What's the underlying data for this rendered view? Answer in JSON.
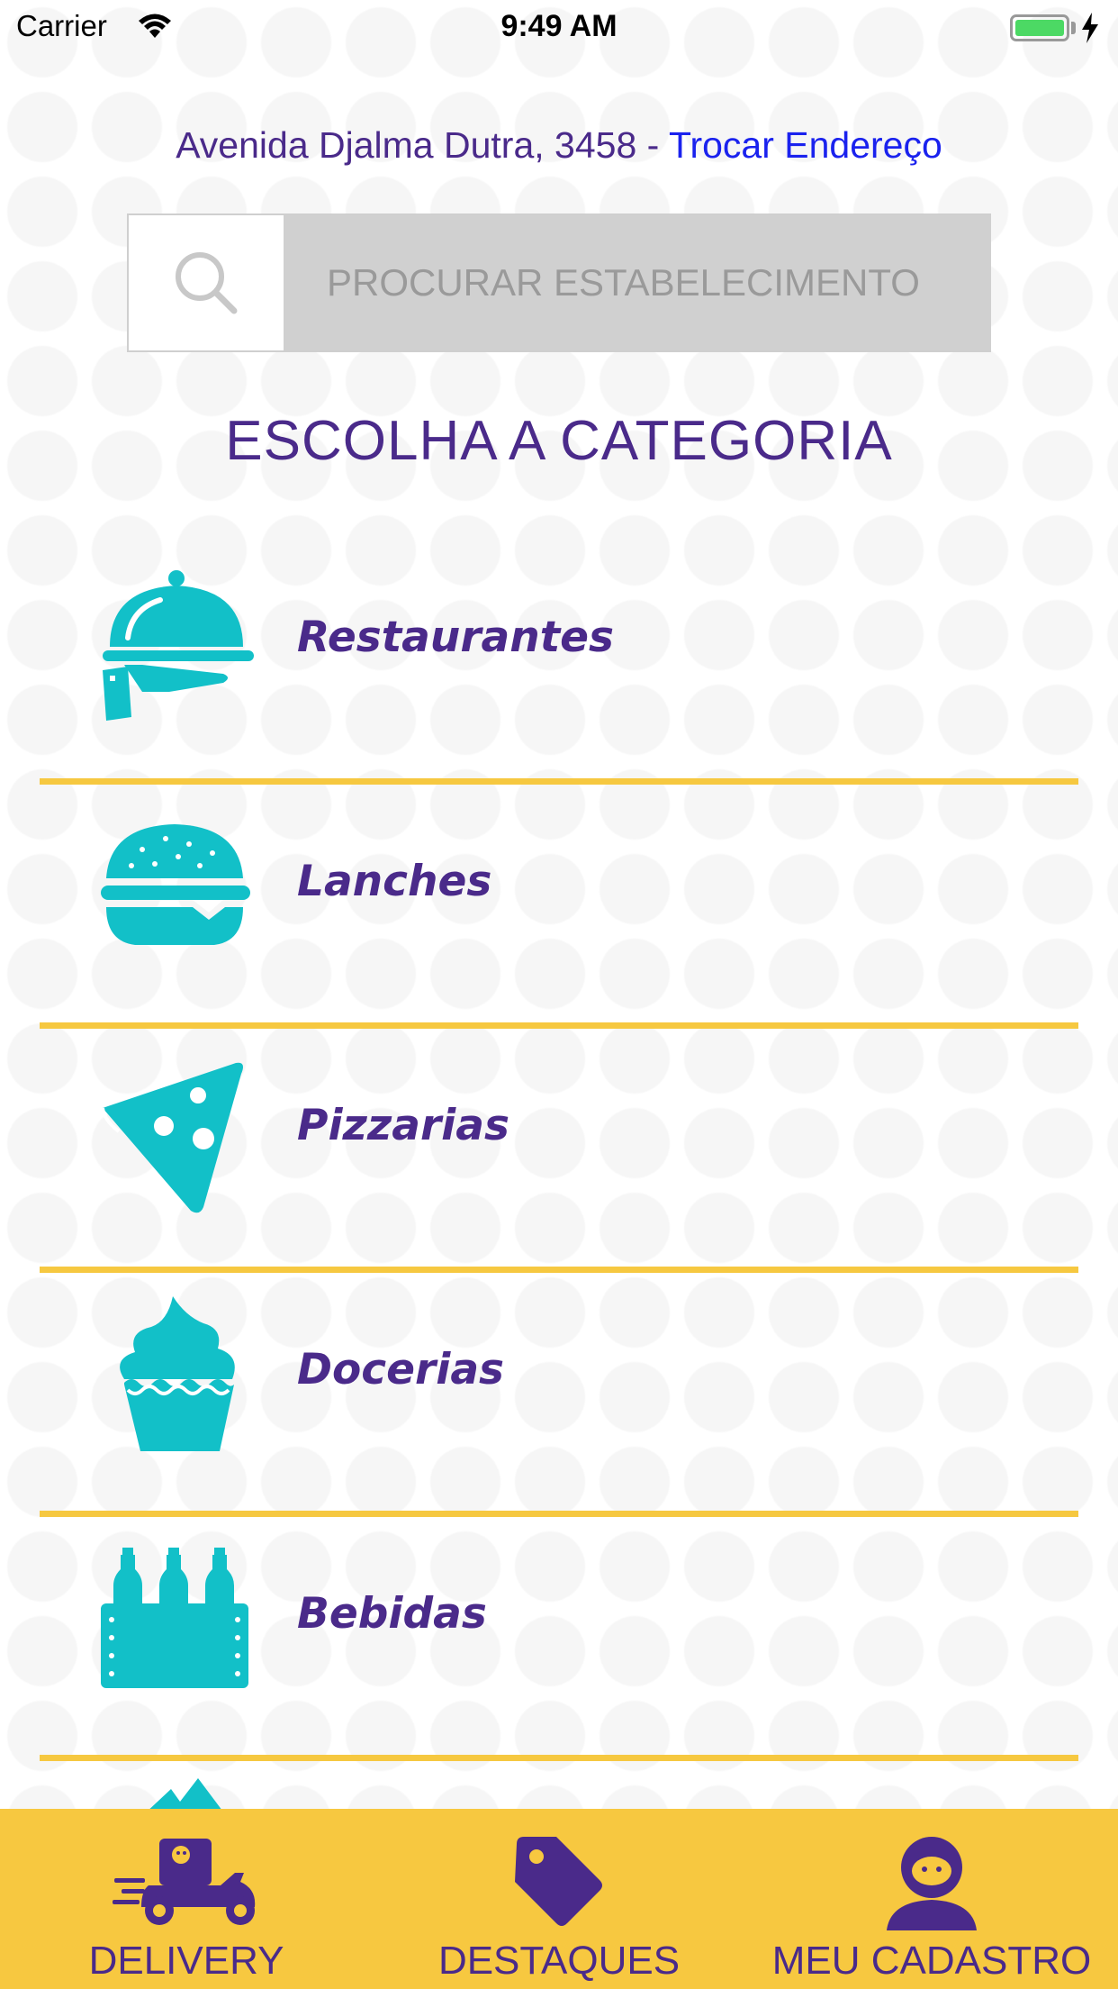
{
  "status_bar": {
    "carrier": "Carrier",
    "time": "9:49 AM",
    "battery_level": 1.0
  },
  "header": {
    "address": "Avenida Djalma Dutra, 3458",
    "separator": " - ",
    "change_address_label": "Trocar Endereço"
  },
  "search": {
    "placeholder": "PROCURAR ESTABELECIMENTO"
  },
  "section_title": "ESCOLHA A CATEGORIA",
  "categories": [
    {
      "label": "Restaurantes",
      "icon": "cloche-icon"
    },
    {
      "label": "Lanches",
      "icon": "burger-icon"
    },
    {
      "label": "Pizzarias",
      "icon": "pizza-slice-icon"
    },
    {
      "label": "Docerias",
      "icon": "cupcake-icon"
    },
    {
      "label": "Bebidas",
      "icon": "bottle-crate-icon"
    }
  ],
  "tab_bar": {
    "tabs": [
      {
        "label": "DELIVERY",
        "icon": "delivery-scooter-icon"
      },
      {
        "label": "DESTAQUES",
        "icon": "tag-icon"
      },
      {
        "label": "MEU CADASTRO",
        "icon": "profile-icon"
      }
    ]
  },
  "colors": {
    "primary_purple": "#4a2a8a",
    "accent_teal": "#12c0c8",
    "accent_yellow": "#f7c840",
    "link_blue": "#1a22ee"
  }
}
